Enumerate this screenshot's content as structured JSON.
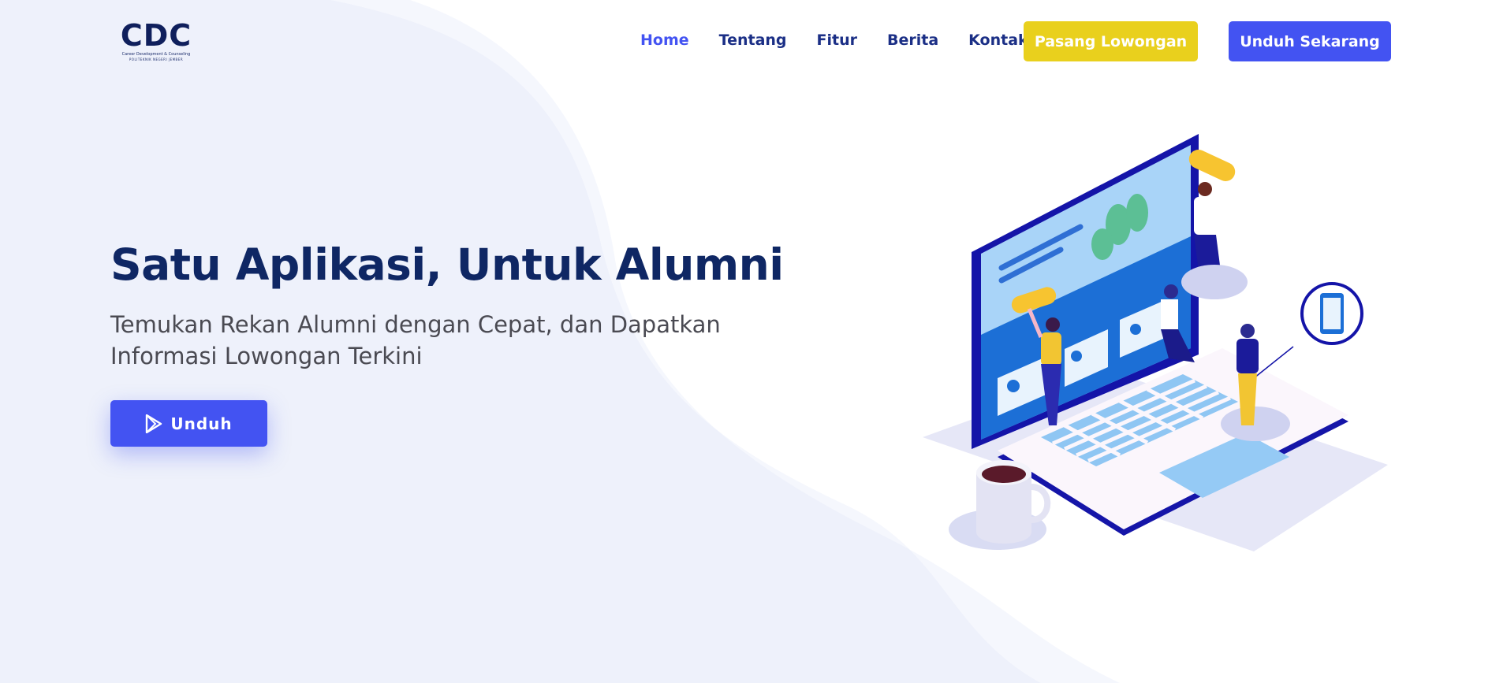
{
  "brand": {
    "logo_text": "CDC",
    "logo_subtitle": "Career Development & Counseling",
    "logo_institution": "POLITEKNIK NEGERI JEMBER"
  },
  "nav": {
    "items": [
      {
        "label": "Home",
        "active": true
      },
      {
        "label": "Tentang",
        "active": false
      },
      {
        "label": "Fitur",
        "active": false
      },
      {
        "label": "Berita",
        "active": false
      },
      {
        "label": "Kontak",
        "active": false
      }
    ],
    "post_job_label": "Pasang Lowongan",
    "download_now_label": "Unduh Sekarang"
  },
  "hero": {
    "title": "Satu Aplikasi, Untuk Alumni",
    "subtitle": "Temukan Rekan Alumni dengan Cepat, dan Dapatkan Informasi Lowongan Terkini",
    "cta_label": "Unduh",
    "cta_icon": "play-store-icon",
    "illustration": "laptop-people-illustration"
  },
  "colors": {
    "primary": "#4353f2",
    "navy": "#0f2764",
    "accent_yellow": "#e9d01d",
    "background_wave": "#eef1fb"
  }
}
